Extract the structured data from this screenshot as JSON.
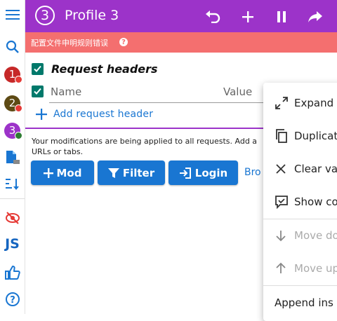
{
  "header": {
    "profile_number": "3",
    "title": "Profile 3",
    "color": "#9c33c9"
  },
  "error_bar": {
    "text": "配置文件申明规则错误",
    "help": "?"
  },
  "rail": {
    "profiles": [
      {
        "num": "1",
        "color": "#c62828",
        "status": "#e53935"
      },
      {
        "num": "2",
        "color": "#5d4a14",
        "status": "#e53935"
      },
      {
        "num": "3",
        "color": "#9c33c9",
        "status": "#2e7d32"
      }
    ],
    "js_label": "JS"
  },
  "section": {
    "title": "Request headers",
    "name_placeholder": "Name",
    "value_placeholder": "Value",
    "add_label": "Add request header"
  },
  "info": {
    "text": "Your modifications are being applied to all requests. Add a URLs or tabs."
  },
  "actions": {
    "mod": "Mod",
    "filter": "Filter",
    "login": "Login",
    "browse": "Bro"
  },
  "menu": {
    "items": [
      {
        "label": "Expand",
        "enabled": true
      },
      {
        "label": "Duplicat",
        "enabled": true
      },
      {
        "label": "Clear va",
        "enabled": true
      },
      {
        "label": "Show co",
        "enabled": true
      },
      {
        "label": "Move do",
        "enabled": false
      },
      {
        "label": "Move up",
        "enabled": false
      },
      {
        "label": "Append ins",
        "enabled": true
      }
    ]
  },
  "colors": {
    "accent": "#1976d2",
    "error": "#f46f6f",
    "checkbox": "#00796b"
  }
}
